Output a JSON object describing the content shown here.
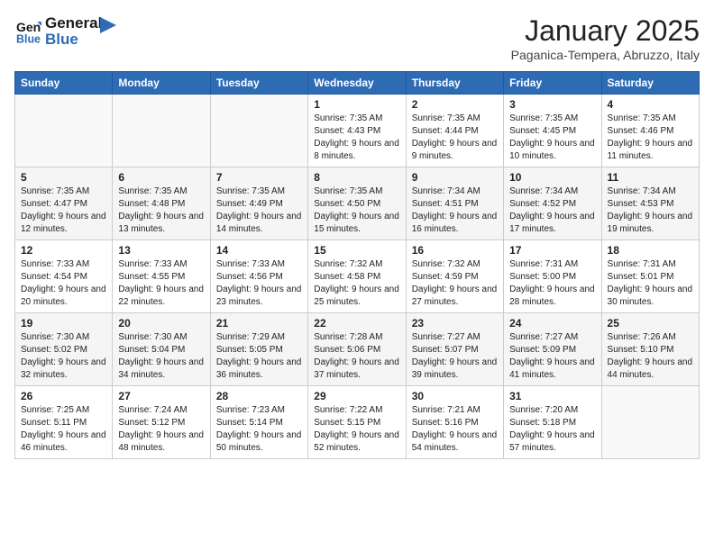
{
  "logo": {
    "line1": "General",
    "line2": "Blue"
  },
  "title": "January 2025",
  "subtitle": "Paganica-Tempera, Abruzzo, Italy",
  "weekdays": [
    "Sunday",
    "Monday",
    "Tuesday",
    "Wednesday",
    "Thursday",
    "Friday",
    "Saturday"
  ],
  "weeks": [
    [
      {
        "day": "",
        "sunrise": "",
        "sunset": "",
        "daylight": ""
      },
      {
        "day": "",
        "sunrise": "",
        "sunset": "",
        "daylight": ""
      },
      {
        "day": "",
        "sunrise": "",
        "sunset": "",
        "daylight": ""
      },
      {
        "day": "1",
        "sunrise": "Sunrise: 7:35 AM",
        "sunset": "Sunset: 4:43 PM",
        "daylight": "Daylight: 9 hours and 8 minutes."
      },
      {
        "day": "2",
        "sunrise": "Sunrise: 7:35 AM",
        "sunset": "Sunset: 4:44 PM",
        "daylight": "Daylight: 9 hours and 9 minutes."
      },
      {
        "day": "3",
        "sunrise": "Sunrise: 7:35 AM",
        "sunset": "Sunset: 4:45 PM",
        "daylight": "Daylight: 9 hours and 10 minutes."
      },
      {
        "day": "4",
        "sunrise": "Sunrise: 7:35 AM",
        "sunset": "Sunset: 4:46 PM",
        "daylight": "Daylight: 9 hours and 11 minutes."
      }
    ],
    [
      {
        "day": "5",
        "sunrise": "Sunrise: 7:35 AM",
        "sunset": "Sunset: 4:47 PM",
        "daylight": "Daylight: 9 hours and 12 minutes."
      },
      {
        "day": "6",
        "sunrise": "Sunrise: 7:35 AM",
        "sunset": "Sunset: 4:48 PM",
        "daylight": "Daylight: 9 hours and 13 minutes."
      },
      {
        "day": "7",
        "sunrise": "Sunrise: 7:35 AM",
        "sunset": "Sunset: 4:49 PM",
        "daylight": "Daylight: 9 hours and 14 minutes."
      },
      {
        "day": "8",
        "sunrise": "Sunrise: 7:35 AM",
        "sunset": "Sunset: 4:50 PM",
        "daylight": "Daylight: 9 hours and 15 minutes."
      },
      {
        "day": "9",
        "sunrise": "Sunrise: 7:34 AM",
        "sunset": "Sunset: 4:51 PM",
        "daylight": "Daylight: 9 hours and 16 minutes."
      },
      {
        "day": "10",
        "sunrise": "Sunrise: 7:34 AM",
        "sunset": "Sunset: 4:52 PM",
        "daylight": "Daylight: 9 hours and 17 minutes."
      },
      {
        "day": "11",
        "sunrise": "Sunrise: 7:34 AM",
        "sunset": "Sunset: 4:53 PM",
        "daylight": "Daylight: 9 hours and 19 minutes."
      }
    ],
    [
      {
        "day": "12",
        "sunrise": "Sunrise: 7:33 AM",
        "sunset": "Sunset: 4:54 PM",
        "daylight": "Daylight: 9 hours and 20 minutes."
      },
      {
        "day": "13",
        "sunrise": "Sunrise: 7:33 AM",
        "sunset": "Sunset: 4:55 PM",
        "daylight": "Daylight: 9 hours and 22 minutes."
      },
      {
        "day": "14",
        "sunrise": "Sunrise: 7:33 AM",
        "sunset": "Sunset: 4:56 PM",
        "daylight": "Daylight: 9 hours and 23 minutes."
      },
      {
        "day": "15",
        "sunrise": "Sunrise: 7:32 AM",
        "sunset": "Sunset: 4:58 PM",
        "daylight": "Daylight: 9 hours and 25 minutes."
      },
      {
        "day": "16",
        "sunrise": "Sunrise: 7:32 AM",
        "sunset": "Sunset: 4:59 PM",
        "daylight": "Daylight: 9 hours and 27 minutes."
      },
      {
        "day": "17",
        "sunrise": "Sunrise: 7:31 AM",
        "sunset": "Sunset: 5:00 PM",
        "daylight": "Daylight: 9 hours and 28 minutes."
      },
      {
        "day": "18",
        "sunrise": "Sunrise: 7:31 AM",
        "sunset": "Sunset: 5:01 PM",
        "daylight": "Daylight: 9 hours and 30 minutes."
      }
    ],
    [
      {
        "day": "19",
        "sunrise": "Sunrise: 7:30 AM",
        "sunset": "Sunset: 5:02 PM",
        "daylight": "Daylight: 9 hours and 32 minutes."
      },
      {
        "day": "20",
        "sunrise": "Sunrise: 7:30 AM",
        "sunset": "Sunset: 5:04 PM",
        "daylight": "Daylight: 9 hours and 34 minutes."
      },
      {
        "day": "21",
        "sunrise": "Sunrise: 7:29 AM",
        "sunset": "Sunset: 5:05 PM",
        "daylight": "Daylight: 9 hours and 36 minutes."
      },
      {
        "day": "22",
        "sunrise": "Sunrise: 7:28 AM",
        "sunset": "Sunset: 5:06 PM",
        "daylight": "Daylight: 9 hours and 37 minutes."
      },
      {
        "day": "23",
        "sunrise": "Sunrise: 7:27 AM",
        "sunset": "Sunset: 5:07 PM",
        "daylight": "Daylight: 9 hours and 39 minutes."
      },
      {
        "day": "24",
        "sunrise": "Sunrise: 7:27 AM",
        "sunset": "Sunset: 5:09 PM",
        "daylight": "Daylight: 9 hours and 41 minutes."
      },
      {
        "day": "25",
        "sunrise": "Sunrise: 7:26 AM",
        "sunset": "Sunset: 5:10 PM",
        "daylight": "Daylight: 9 hours and 44 minutes."
      }
    ],
    [
      {
        "day": "26",
        "sunrise": "Sunrise: 7:25 AM",
        "sunset": "Sunset: 5:11 PM",
        "daylight": "Daylight: 9 hours and 46 minutes."
      },
      {
        "day": "27",
        "sunrise": "Sunrise: 7:24 AM",
        "sunset": "Sunset: 5:12 PM",
        "daylight": "Daylight: 9 hours and 48 minutes."
      },
      {
        "day": "28",
        "sunrise": "Sunrise: 7:23 AM",
        "sunset": "Sunset: 5:14 PM",
        "daylight": "Daylight: 9 hours and 50 minutes."
      },
      {
        "day": "29",
        "sunrise": "Sunrise: 7:22 AM",
        "sunset": "Sunset: 5:15 PM",
        "daylight": "Daylight: 9 hours and 52 minutes."
      },
      {
        "day": "30",
        "sunrise": "Sunrise: 7:21 AM",
        "sunset": "Sunset: 5:16 PM",
        "daylight": "Daylight: 9 hours and 54 minutes."
      },
      {
        "day": "31",
        "sunrise": "Sunrise: 7:20 AM",
        "sunset": "Sunset: 5:18 PM",
        "daylight": "Daylight: 9 hours and 57 minutes."
      },
      {
        "day": "",
        "sunrise": "",
        "sunset": "",
        "daylight": ""
      }
    ]
  ]
}
